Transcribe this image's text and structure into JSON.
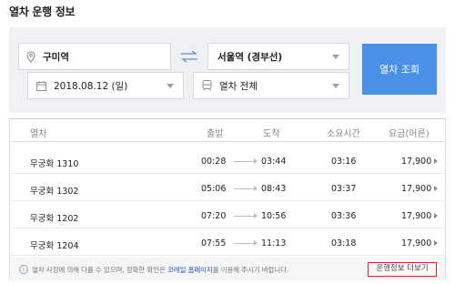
{
  "page": {
    "title": "열차 운행 정보"
  },
  "search": {
    "departure": "구미역",
    "arrival": "서울역 (경부선)",
    "date": "2018.08.12 (일)",
    "train_type": "열차 전체",
    "search_button": "열차 조회"
  },
  "table": {
    "headers": {
      "train": "열차",
      "departure": "출발",
      "arrival": "도착",
      "duration": "소요시간",
      "fare": "요금(어른)"
    },
    "rows": [
      {
        "train": "무궁화 1310",
        "dep": "00:28",
        "arr": "03:44",
        "duration": "03:16",
        "fare": "17,900"
      },
      {
        "train": "무궁화 1302",
        "dep": "05:06",
        "arr": "08:43",
        "duration": "03:37",
        "fare": "17,900"
      },
      {
        "train": "무궁화 1202",
        "dep": "07:20",
        "arr": "10:56",
        "duration": "03:36",
        "fare": "17,900"
      },
      {
        "train": "무궁화 1204",
        "dep": "07:55",
        "arr": "11:13",
        "duration": "03:18",
        "fare": "17,900"
      }
    ]
  },
  "notice": {
    "text_before": "열차 사정에 의해 다를 수 있으며, 정확한 확인은 ",
    "link": "코레일 홈페이지",
    "text_after": "를 이용해 주시기 바랍니다.",
    "more_button": "운행정보 더보기"
  },
  "colors": {
    "accent": "#4a90e8",
    "highlight_border": "#e02020",
    "link": "#2a4fb8"
  }
}
